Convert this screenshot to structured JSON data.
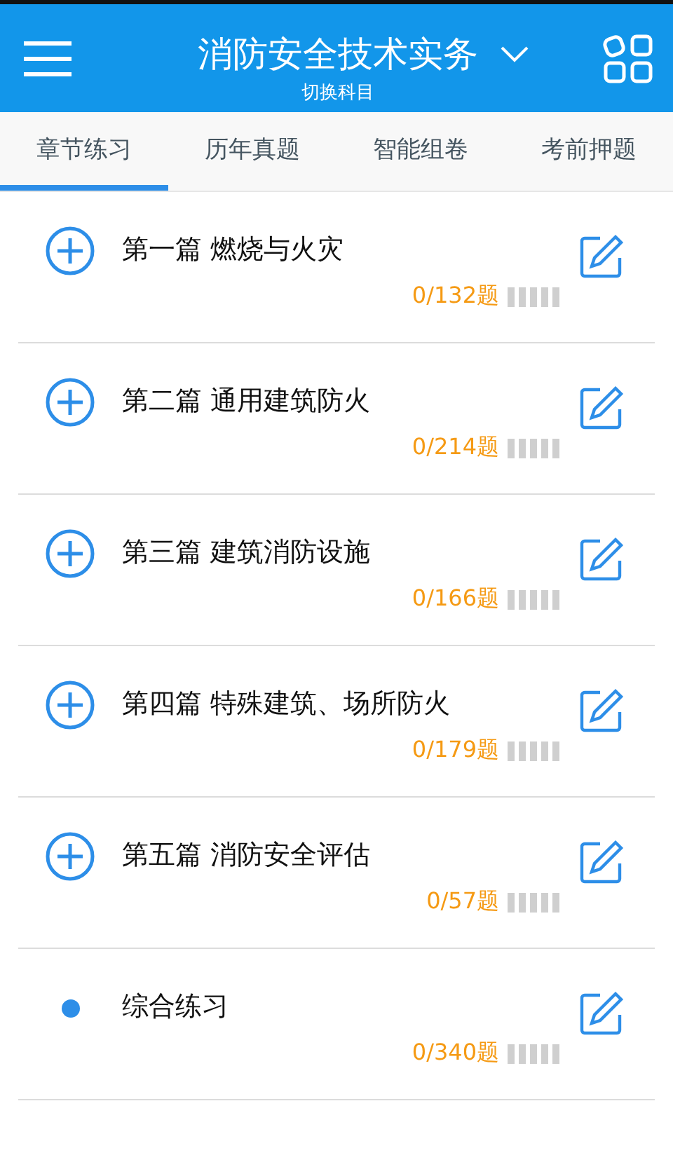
{
  "header": {
    "title": "消防安全技术实务",
    "subtitle": "切换科目"
  },
  "tabs": [
    {
      "label": "章节练习",
      "selected": true
    },
    {
      "label": "历年真题",
      "selected": false
    },
    {
      "label": "智能组卷",
      "selected": false
    },
    {
      "label": "考前押题",
      "selected": false
    }
  ],
  "chapters": [
    {
      "kind": "chapter",
      "title": "第一篇 燃烧与火灾",
      "count": "0/132题",
      "level": 0
    },
    {
      "kind": "chapter",
      "title": "第二篇 通用建筑防火",
      "count": "0/214题",
      "level": 0
    },
    {
      "kind": "chapter",
      "title": "第三篇 建筑消防设施",
      "count": "0/166题",
      "level": 0
    },
    {
      "kind": "chapter",
      "title": "第四篇 特殊建筑、场所防火",
      "count": "0/179题",
      "level": 0
    },
    {
      "kind": "chapter",
      "title": "第五篇 消防安全评估",
      "count": "0/57题",
      "level": 0
    },
    {
      "kind": "summary",
      "title": "综合练习",
      "count": "0/340题",
      "level": 0
    }
  ]
}
